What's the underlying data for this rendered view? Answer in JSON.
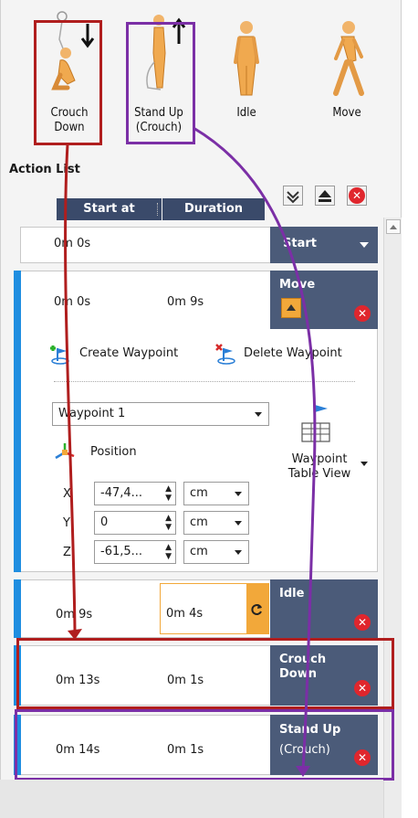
{
  "poses": [
    {
      "label": "Crouch\nDown",
      "line1": "Crouch",
      "line2": "Down"
    },
    {
      "label": "Stand Up\n(Crouch)",
      "line1": "Stand Up",
      "line2": "(Crouch)"
    },
    {
      "label": "Idle",
      "line1": "Idle",
      "line2": ""
    },
    {
      "label": "Move",
      "line1": "Move",
      "line2": ""
    }
  ],
  "action_list": {
    "title": "Action List",
    "col_start": "Start at",
    "col_duration": "Duration"
  },
  "rows": {
    "start": {
      "start_at": "0m 0s",
      "label": "Start"
    },
    "move": {
      "start_at": "0m 0s",
      "duration": "0m 9s",
      "label": "Move"
    },
    "idle": {
      "start_at": "0m 9s",
      "duration": "0m 4s",
      "label": "Idle"
    },
    "crouch": {
      "start_at": "0m 13s",
      "duration": "0m 1s",
      "label_line1": "Crouch",
      "label_line2": "Down"
    },
    "standup": {
      "start_at": "0m 14s",
      "duration": "0m 1s",
      "label_line1": "Stand Up",
      "label_line2": "(Crouch)"
    }
  },
  "waypoint": {
    "create_label": "Create Waypoint",
    "delete_label": "Delete Waypoint",
    "selected": "Waypoint 1",
    "position_label": "Position",
    "table_view_line1": "Waypoint",
    "table_view_line2": "Table View",
    "coords": [
      {
        "axis": "X",
        "value": "-47,4...",
        "unit": "cm"
      },
      {
        "axis": "Y",
        "value": "0",
        "unit": "cm"
      },
      {
        "axis": "Z",
        "value": "-61,5...",
        "unit": "cm"
      }
    ]
  },
  "colors": {
    "highlight_red": "#b01e1e",
    "highlight_purple": "#7b2fa6",
    "row_bar_blue": "#1f8ee0",
    "side_panel": "#4b5b79",
    "delete_red": "#e0262d",
    "accent_orange": "#f2a83a"
  }
}
